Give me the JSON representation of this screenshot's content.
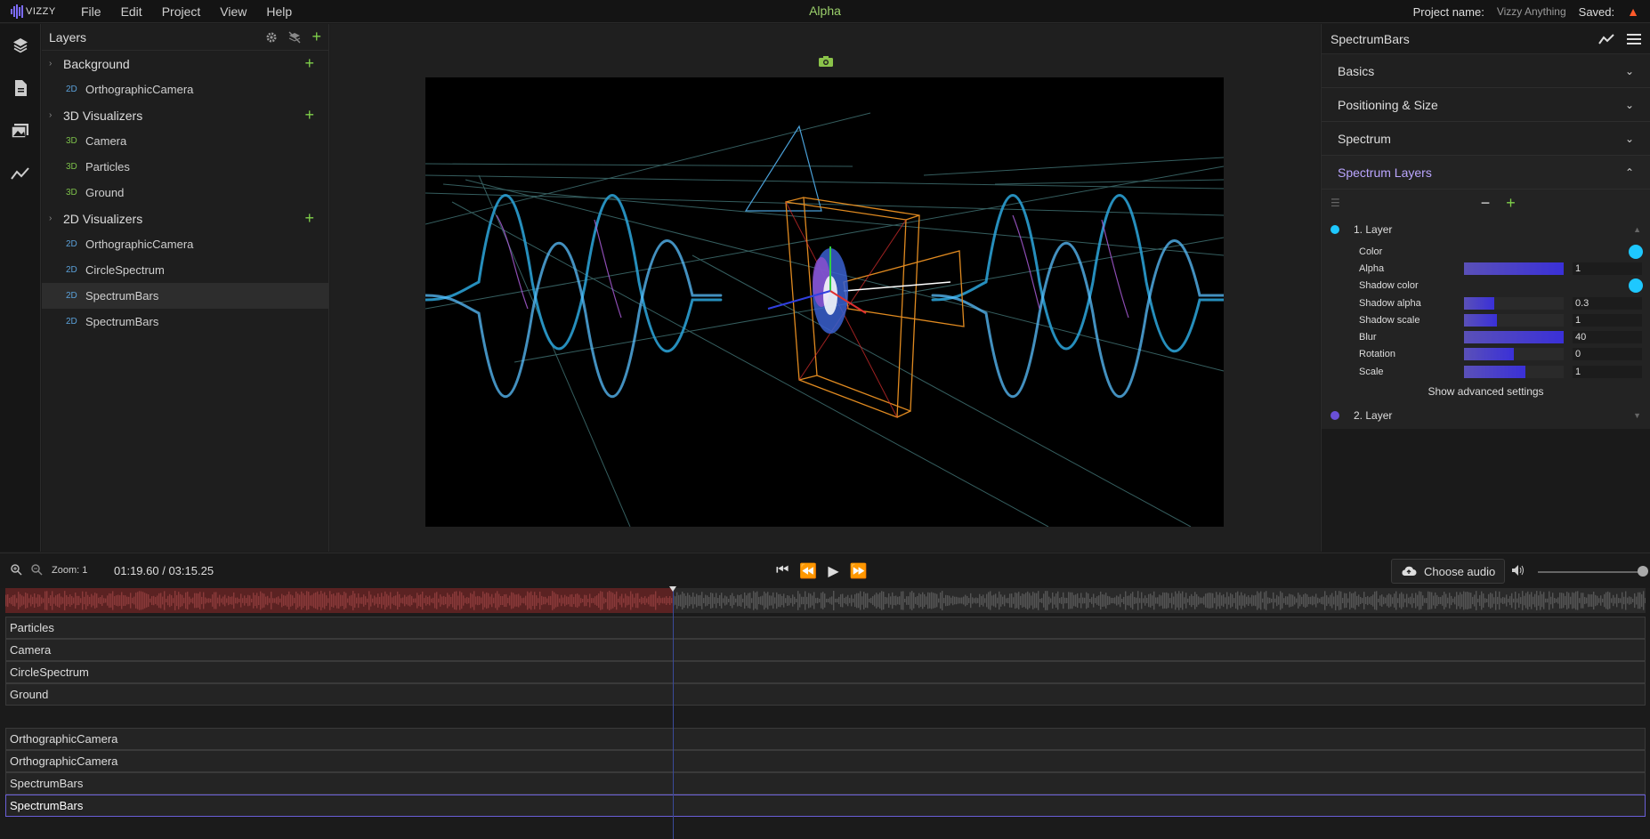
{
  "app": {
    "logo_text": "VIZZY",
    "menu": [
      "File",
      "Edit",
      "Project",
      "View",
      "Help"
    ],
    "title": "Alpha",
    "project_label": "Project name:",
    "project_name": "Vizzy Anything",
    "saved_label": "Saved:",
    "warning_icon": "warning-icon"
  },
  "sidebar_icons": [
    "layers-icon",
    "document-icon",
    "images-icon",
    "graph-icon"
  ],
  "layers": {
    "title": "Layers",
    "groups": [
      {
        "name": "Background",
        "items": [
          {
            "dim": "2D",
            "name": "OrthographicCamera"
          }
        ]
      },
      {
        "name": "3D Visualizers",
        "items": [
          {
            "dim": "3D",
            "name": "Camera"
          },
          {
            "dim": "3D",
            "name": "Particles"
          },
          {
            "dim": "3D",
            "name": "Ground"
          }
        ]
      },
      {
        "name": "2D Visualizers",
        "items": [
          {
            "dim": "2D",
            "name": "OrthographicCamera"
          },
          {
            "dim": "2D",
            "name": "CircleSpectrum"
          },
          {
            "dim": "2D",
            "name": "SpectrumBars",
            "selected": true
          },
          {
            "dim": "2D",
            "name": "SpectrumBars"
          }
        ]
      }
    ]
  },
  "props": {
    "title": "SpectrumBars",
    "sections": [
      "Basics",
      "Positioning & Size",
      "Spectrum",
      "Spectrum Layers"
    ],
    "layer1": {
      "name": "1. Layer",
      "dot_color": "#1ec8ff",
      "rows": [
        {
          "label": "Color",
          "type": "color",
          "color": "#1ec8ff"
        },
        {
          "label": "Alpha",
          "type": "slider",
          "fill": 1.0,
          "value": "1"
        },
        {
          "label": "Shadow color",
          "type": "color",
          "color": "#1ec8ff"
        },
        {
          "label": "Shadow alpha",
          "type": "slider",
          "fill": 0.3,
          "value": "0.3"
        },
        {
          "label": "Shadow scale",
          "type": "slider",
          "fill": 0.33,
          "value": "1"
        },
        {
          "label": "Blur",
          "type": "slider",
          "fill": 1.0,
          "value": "40"
        },
        {
          "label": "Rotation",
          "type": "slider",
          "fill": 0.5,
          "value": "0"
        },
        {
          "label": "Scale",
          "type": "slider",
          "fill": 0.62,
          "value": "1"
        }
      ],
      "advanced": "Show advanced settings"
    },
    "layer2": {
      "name": "2. Layer",
      "dot_color": "#6a50d8"
    }
  },
  "timeline": {
    "zoom": "Zoom: 1",
    "time": "01:19.60 / 03:15.25",
    "choose_audio": "Choose audio",
    "volume": 1.0,
    "tracks": [
      "Particles",
      "Camera",
      "CircleSpectrum",
      "Ground",
      "",
      "OrthographicCamera",
      "OrthographicCamera",
      "SpectrumBars",
      "SpectrumBars"
    ]
  },
  "colors": {
    "accent": "#7fd04a",
    "title": "#9bd06b",
    "selection": "#6a5fd8"
  }
}
